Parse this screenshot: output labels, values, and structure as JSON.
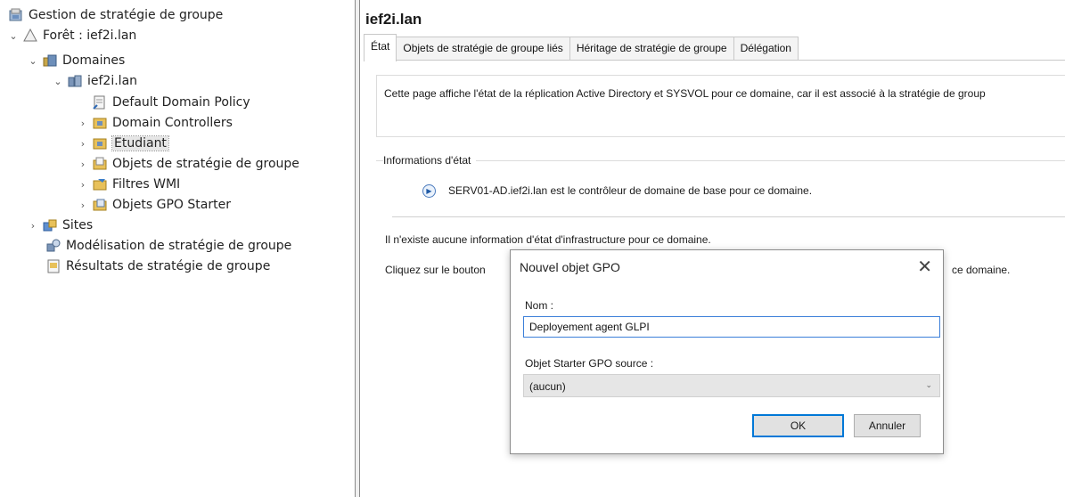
{
  "tree": {
    "root": "Gestion de stratégie de groupe",
    "forest": "Forêt : ief2i.lan",
    "domains": "Domaines",
    "domain": "ief2i.lan",
    "items": [
      "Default Domain Policy",
      "Domain Controllers",
      "Etudiant",
      "Objets de stratégie de groupe",
      "Filtres WMI",
      "Objets GPO Starter"
    ],
    "sites": "Sites",
    "modeling": "Modélisation de stratégie de groupe",
    "results": "Résultats de stratégie de groupe"
  },
  "main": {
    "title": "ief2i.lan",
    "tabs": [
      "État",
      "Objets de stratégie de groupe liés",
      "Héritage de stratégie de groupe",
      "Délégation"
    ],
    "description": "Cette page affiche l'état de la réplication Active Directory et SYSVOL pour ce domaine, car il est associé à la stratégie de group",
    "status_group_label": "Informations d'état",
    "status_info": "SERV01-AD.ief2i.lan est le contrôleur de domaine de base pour ce domaine.",
    "infra_text": "Il n'existe aucune information d'état d'infrastructure pour ce domaine.",
    "click_text": "Cliquez sur le bouton",
    "click_tail": "ce domaine."
  },
  "dialog": {
    "title": "Nouvel objet GPO",
    "close": "✕",
    "name_label": "Nom :",
    "name_value": "Deployement agent GLPI",
    "starter_label": "Objet Starter GPO source :",
    "starter_value": "(aucun)",
    "ok": "OK",
    "cancel": "Annuler"
  },
  "icons": {
    "collapsed": "›",
    "expanded": "⌄",
    "info": "▶",
    "dropdown": "⌄"
  }
}
